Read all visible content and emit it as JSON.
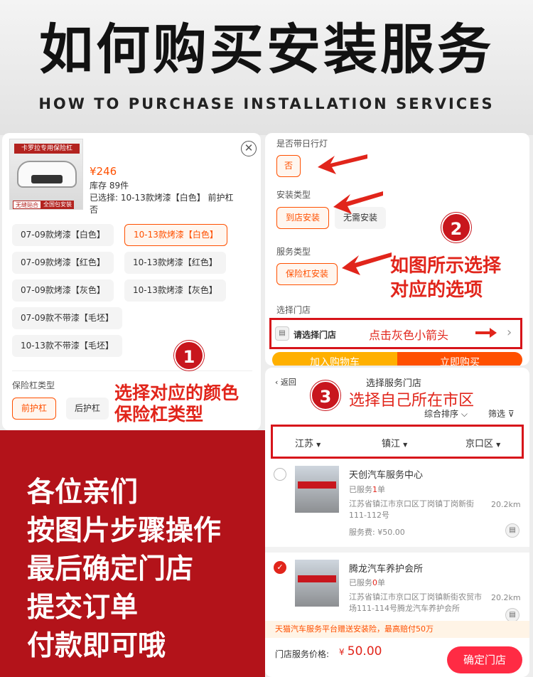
{
  "header": {
    "title": "如何购买安装服务",
    "subtitle": "HOW TO PURCHASE INSTALLATION SERVICES"
  },
  "product": {
    "image_banner": "卡罗拉专用保险杠",
    "image_tag_left": "无缝贴合",
    "image_tag_right": "全国包安装",
    "price": "¥246",
    "stock": "库存 89件",
    "selected_line1": "已选择: 10-13款烤漆【白色】   前护杠",
    "selected_line2": "否",
    "close_icon": "close-icon",
    "variants": [
      "07-09款烤漆【白色】",
      "10-13款烤漆【白色】",
      "07-09款烤漆【红色】",
      "10-13款烤漆【红色】",
      "07-09款烤漆【灰色】",
      "10-13款烤漆【灰色】",
      "07-09款不带漆【毛坯】",
      "10-13款不带漆【毛坯】"
    ],
    "selected_variant": "10-13款烤漆【白色】",
    "bumper_type_label": "保险杠类型",
    "bumper_types": [
      "前护杠",
      "后护杠"
    ],
    "selected_bumper_type": "前护杠"
  },
  "options": {
    "daylight_label": "是否带日行灯",
    "daylight_value": "否",
    "install_type_label": "安装类型",
    "install_types": [
      "到店安装",
      "无需安装"
    ],
    "service_type_label": "服务类型",
    "service_type_value": "保险杠安装",
    "store_label": "选择门店",
    "store_placeholder": "请选择门店",
    "add_cart": "加入购物车",
    "buy_now": "立即购买"
  },
  "annotations": {
    "step1": "1",
    "step1_text": [
      "选择对应的颜色",
      "保险杠类型"
    ],
    "step2": "2",
    "step2_text": [
      "如图所示选择",
      "对应的选项"
    ],
    "step3": "3",
    "step3_text": "选择自己所在市区",
    "tap_arrow_text": "点击灰色小箭头"
  },
  "store_picker": {
    "back": "返回",
    "title": "选择服务门店",
    "sort": "综合排序",
    "filter": "筛选",
    "province": "江苏",
    "city": "镇江",
    "district": "京口区",
    "stores": [
      {
        "name": "天创汽车服务中心",
        "served_prefix": "已服务",
        "served_count": "1",
        "served_suffix": "单",
        "address": "江苏省镇江市京口区丁岗镇丁岗新街111-112号",
        "distance": "20.2km",
        "fee": "服务费: ¥50.00",
        "selected": false
      },
      {
        "name": "腾龙汽车养护会所",
        "served_prefix": "已服务",
        "served_count": "0",
        "served_suffix": "单",
        "address": "江苏省镇江市京口区丁岗镇新街农贸市场111-114号腾龙汽车养护会所",
        "distance": "20.2km",
        "selected": true
      }
    ],
    "notice": "天猫汽车服务平台赠送安装险，最高赔付50万",
    "price_label": "门店服务价格:",
    "price_symbol": "¥",
    "price_value": "50.00",
    "confirm": "确定门店"
  },
  "instructions": [
    "各位亲们",
    "按图片步骤操作",
    "最后确定门店",
    "提交订单",
    "付款即可哦"
  ],
  "colors": {
    "accent_orange": "#ff5000",
    "annotation_red": "#e1251b",
    "banner_red": "#b3131a"
  }
}
